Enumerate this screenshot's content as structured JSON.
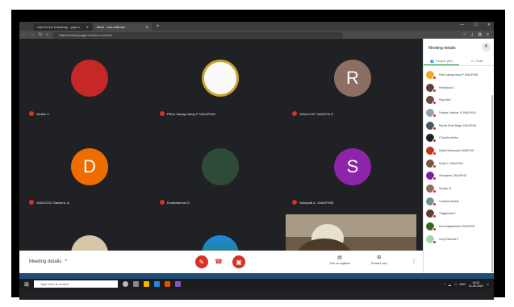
{
  "browser": {
    "tabs": [
      {
        "label": "Link for the workshop - pays.c",
        "active": false
      },
      {
        "label": "Meet - nnu-rxdf-hoz",
        "active": true
      }
    ],
    "new_tab": "+",
    "url": "https://meet.google.com/nnu-rxdf-hoz"
  },
  "tiles": [
    {
      "name": "Jenifer V",
      "initial": "",
      "color": "#c62828"
    },
    {
      "name": "PMJo Sahaya Mary P 19AUPH05",
      "initial": "",
      "color": "#fafafa"
    },
    {
      "name": "19AUCH37 VANATHI R",
      "initial": "R",
      "color": "#8d6e63"
    },
    {
      "name": "19AUCH11 Sakeera. A",
      "initial": "D",
      "color": "#ef6c00"
    },
    {
      "name": "Evakkiammal G",
      "initial": "",
      "color": "#2e4b3a"
    },
    {
      "name": "Sahayalil A. 19AUPH05",
      "initial": "S",
      "color": "#8e24aa"
    },
    {
      "name": "",
      "initial": "",
      "color": "#d7c7a8"
    },
    {
      "name": "",
      "initial": "",
      "color": "#1e88e5"
    }
  ],
  "bottom_bar": {
    "meeting_details": "Meeting details",
    "captions_label": "Turn on captions",
    "present_label": "Present now"
  },
  "panel": {
    "title": "Meeting details",
    "people_tab": "People (62)",
    "chat_tab": "Chat",
    "participants": [
      {
        "name": "Philo Sahaya Mary P 19AUPH05",
        "color": "#f9a825"
      },
      {
        "name": "Prathiksha S",
        "color": "#5d4037"
      },
      {
        "name": "Priya Alex",
        "color": "#6d4c41"
      },
      {
        "name": "Pushpa Lakshmi. B 19AUPH10",
        "color": "#90a4ae"
      },
      {
        "name": "Rachel Rose Magie 19AUPH04",
        "color": "#455a64"
      },
      {
        "name": "S Santha Muthu",
        "color": "#212121"
      },
      {
        "name": "Sakthi Maheswari 19AUPH05",
        "color": "#bf360c"
      },
      {
        "name": "Selcia.C 19AUPH06",
        "color": "#795548"
      },
      {
        "name": "Shreyanka. 19AUPH45",
        "color": "#7b1fa2"
      },
      {
        "name": "Sindiya. M",
        "color": "#8d6e63"
      },
      {
        "name": "T.Anisha Nivetha",
        "color": "#78909c"
      },
      {
        "name": "Thagammal S",
        "color": "#5d4037"
      },
      {
        "name": "Uma Nagalakshmi 19AUPH08",
        "color": "#33691e"
      },
      {
        "name": "Vinoj Rebekha P",
        "color": "#a5d6a7"
      }
    ]
  },
  "taskbar": {
    "search_placeholder": "Type here to search",
    "time": "19:03",
    "date": "11-06-2020",
    "lang": "ENG"
  }
}
